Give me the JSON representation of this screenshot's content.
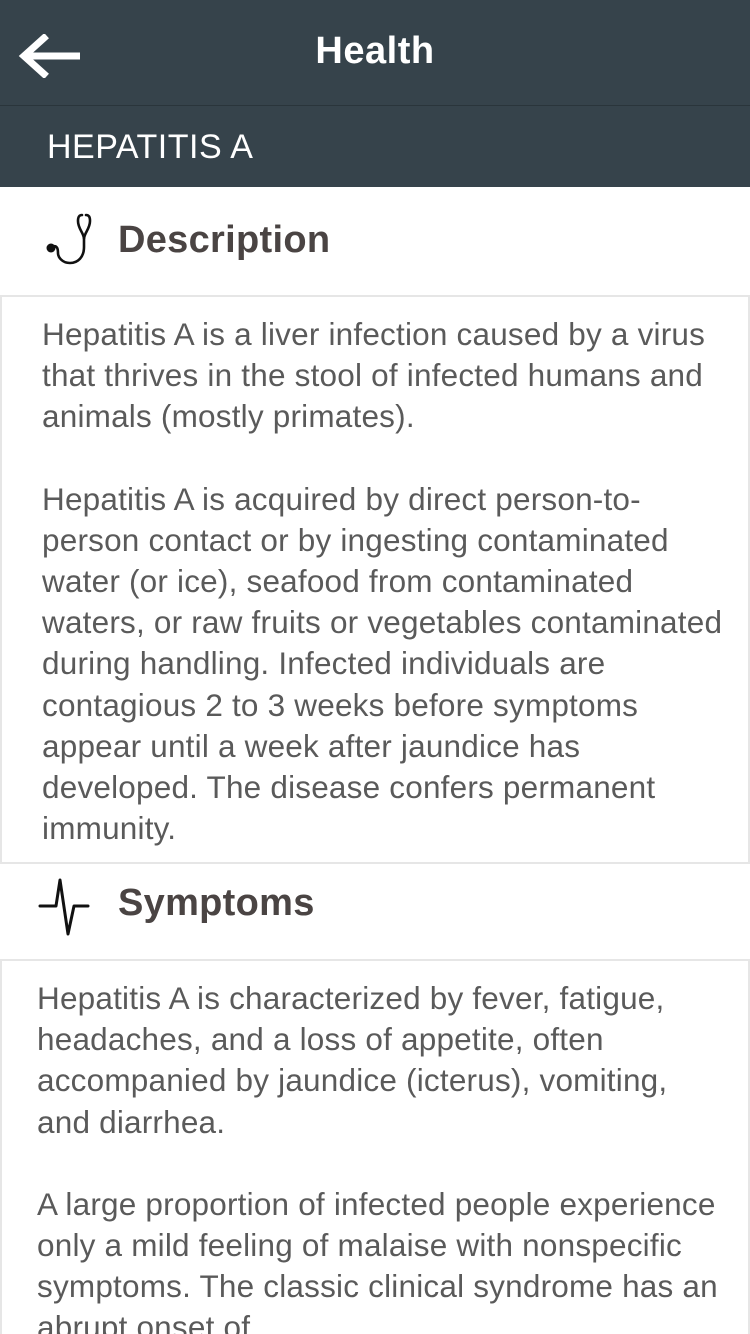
{
  "header": {
    "title": "Health",
    "subtitle": "HEPATITIS A",
    "back_icon": "arrow-left-icon"
  },
  "sections": [
    {
      "title": "Description",
      "icon": "stethoscope-icon",
      "paragraphs": [
        "Hepatitis A is a liver infection caused by a virus that thrives in the stool of infected humans and animals (mostly primates).",
        "Hepatitis A is acquired by direct person-to-person contact or by ingesting contaminated water (or ice), seafood from contaminated waters, or raw fruits or vegetables contaminated during handling. Infected individuals are contagious 2 to 3 weeks before symptoms appear until a week after jaundice has developed. The disease confers permanent immunity."
      ]
    },
    {
      "title": "Symptoms",
      "icon": "heartbeat-pulse-icon",
      "paragraphs": [
        "Hepatitis A is characterized by fever, fatigue, headaches, and a loss of appetite, often accompanied by jaundice (icterus), vomiting, and diarrhea.",
        "A large proportion of infected people experience only a mild feeling of malaise with nonspecific symptoms. The classic clinical syndrome has an abrupt onset of"
      ]
    }
  ],
  "colors": {
    "header_bg": "#36434b",
    "text": "#5a5a5a",
    "section_title": "#4a4443",
    "card_border": "#e6e6e6"
  }
}
